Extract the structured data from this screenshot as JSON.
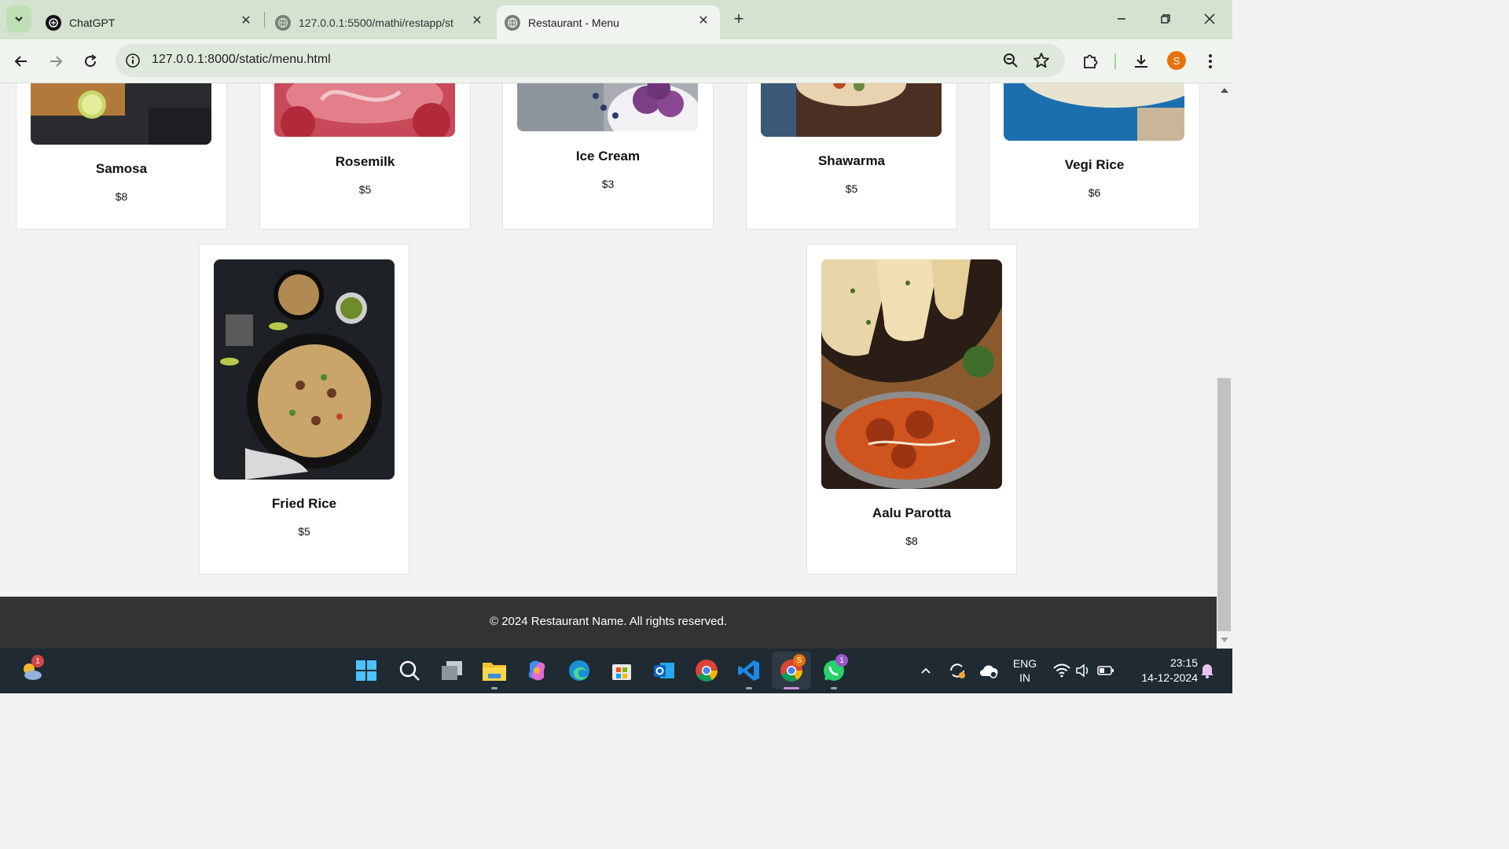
{
  "browser": {
    "tabs": [
      {
        "title": "ChatGPT",
        "icon": "chatgpt-icon",
        "active": false
      },
      {
        "title": "127.0.0.1:5500/mathi/restapp/st",
        "icon": "globe-icon",
        "active": false
      },
      {
        "title": "Restaurant - Menu",
        "icon": "globe-icon",
        "active": true
      }
    ],
    "url": "127.0.0.1:8000/static/menu.html",
    "profile_initial": "S"
  },
  "menu": {
    "row1": [
      {
        "name": "Samosa",
        "price": "$8"
      },
      {
        "name": "Rosemilk",
        "price": "$5"
      },
      {
        "name": "Ice Cream",
        "price": "$3"
      },
      {
        "name": "Shawarma",
        "price": "$5"
      },
      {
        "name": "Vegi Rice",
        "price": "$6"
      }
    ],
    "row2": [
      {
        "name": "Fried Rice",
        "price": "$5"
      },
      {
        "name": "Aalu Parotta",
        "price": "$8"
      }
    ]
  },
  "footer": {
    "text": "© 2024 Restaurant Name. All rights reserved."
  },
  "taskbar": {
    "weather_badge": "1",
    "chrome_badge": "S",
    "whatsapp_badge": "1",
    "lang_line1": "ENG",
    "lang_line2": "IN",
    "time": "23:15",
    "date": "14-12-2024"
  }
}
